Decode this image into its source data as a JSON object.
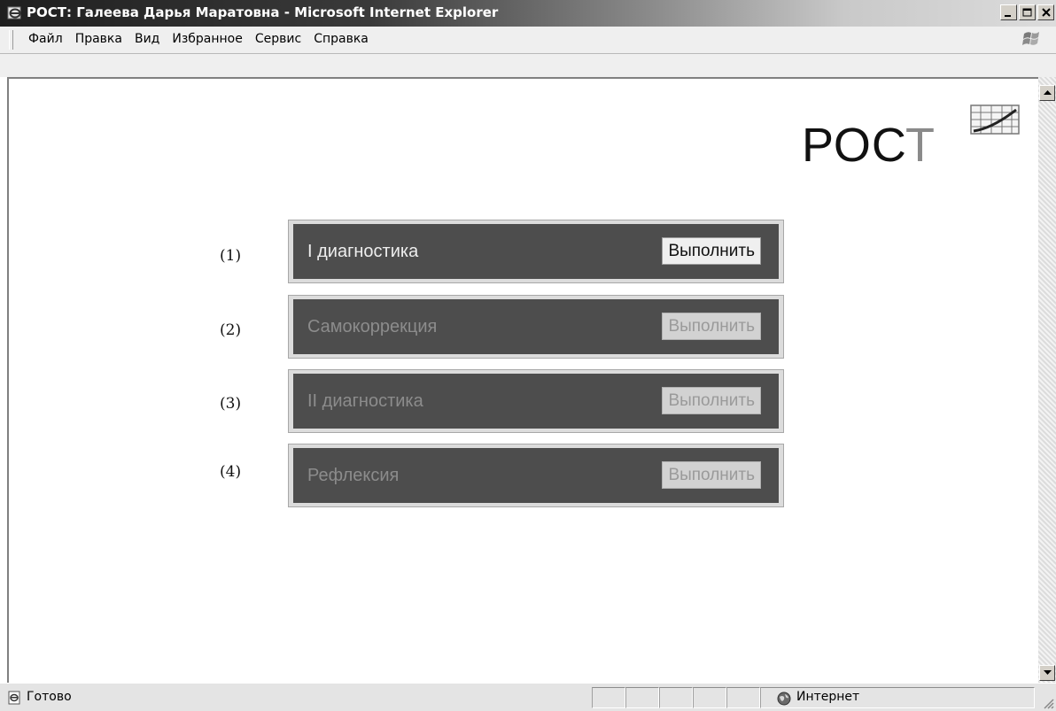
{
  "window": {
    "title": "РОСТ: Галеева Дарья Маратовна - Microsoft Internet Explorer",
    "icon": "ie-icon",
    "controls": [
      "minimize-icon",
      "maximize-icon",
      "close-icon"
    ]
  },
  "menu": {
    "items": [
      "Файл",
      "Правка",
      "Вид",
      "Избранное",
      "Сервис",
      "Справка"
    ],
    "logo_icon": "windows-logo-icon"
  },
  "logo": {
    "text_main": "РОС",
    "text_last": "Т",
    "icon": "growth-chart-icon",
    "colors": {
      "main": "#111111",
      "last": "#8a8a8a"
    }
  },
  "tasks": [
    {
      "number": "(1)",
      "label": "I диагностика",
      "button": "Выполнить",
      "enabled": true
    },
    {
      "number": "(2)",
      "label": "Самокоррекция",
      "button": "Выполнить",
      "enabled": false
    },
    {
      "number": "(3)",
      "label": "II диагностика",
      "button": "Выполнить",
      "enabled": false
    },
    {
      "number": "(4)",
      "label": "Рефлексия",
      "button": "Выполнить",
      "enabled": false
    }
  ],
  "status": {
    "text": "Готово",
    "zone": "Интернет",
    "icons": [
      "page-done-icon",
      "internet-zone-icon"
    ]
  },
  "colors": {
    "panel_bg": "#4d4d4d",
    "panel_border": "#dcdcdc",
    "active_text": "#eeeeee",
    "disabled_text": "#8c8c8c"
  }
}
